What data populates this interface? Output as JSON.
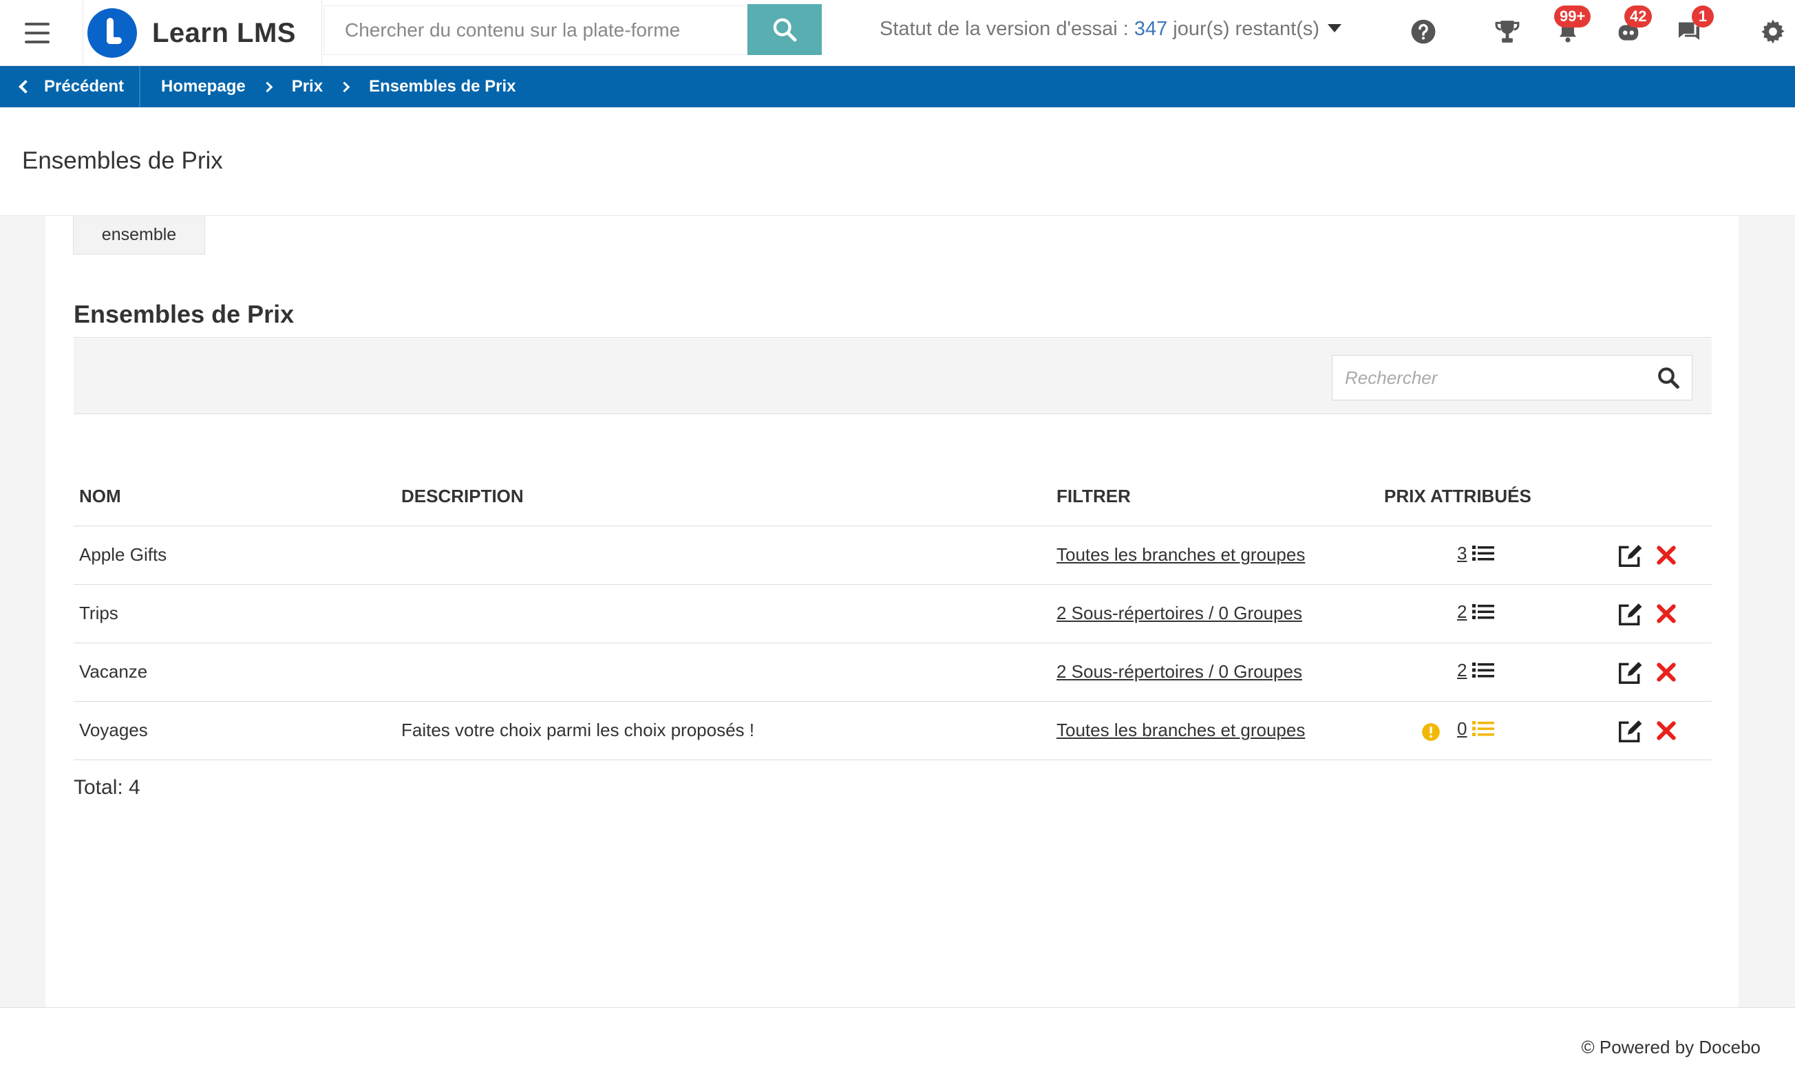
{
  "header": {
    "brand": "Learn LMS",
    "search_placeholder": "Chercher du contenu sur la plate-forme",
    "trial_prefix": "Statut de la version d'essai : ",
    "trial_days": "347",
    "trial_suffix": " jour(s) restant(s)",
    "badges": {
      "notifications": "99+",
      "bot": "42",
      "messages": "1"
    },
    "icons": [
      "menu-icon",
      "search-icon",
      "help-icon",
      "trophy-icon",
      "bell-icon",
      "bot-icon",
      "chat-icon",
      "gear-icon"
    ]
  },
  "breadcrumb": {
    "back_label": "Précédent",
    "items": [
      "Homepage",
      "Prix",
      "Ensembles de Prix"
    ]
  },
  "page": {
    "title": "Ensembles de Prix",
    "tab_label": "ensemble"
  },
  "section": {
    "title": "Ensembles de Prix",
    "search_placeholder": "Rechercher"
  },
  "table": {
    "columns": [
      "NOM",
      "DESCRIPTION",
      "FILTRER",
      "PRIX ATTRIBUÉS"
    ],
    "rows": [
      {
        "name": "Apple Gifts",
        "description": "",
        "filter": "Toutes les branches et groupes",
        "count": "3"
      },
      {
        "name": "Trips",
        "description": "",
        "filter": "2 Sous-répertoires / 0 Groupes",
        "count": "2"
      },
      {
        "name": "Vacanze",
        "description": "",
        "filter": "2 Sous-répertoires / 0 Groupes",
        "count": "2"
      },
      {
        "name": "Voyages",
        "description": "Faites votre choix parmi les choix proposés !",
        "filter": "Toutes les branches et groupes",
        "count": "0"
      }
    ]
  },
  "total_label": "Total: 4",
  "footer": "© Powered by Docebo",
  "colors": {
    "brand_blue": "#0465ac",
    "search_button": "#58aeb0",
    "badge_red": "#e53935",
    "delete_red": "#e8211c",
    "warning_yellow": "#f2b705"
  }
}
